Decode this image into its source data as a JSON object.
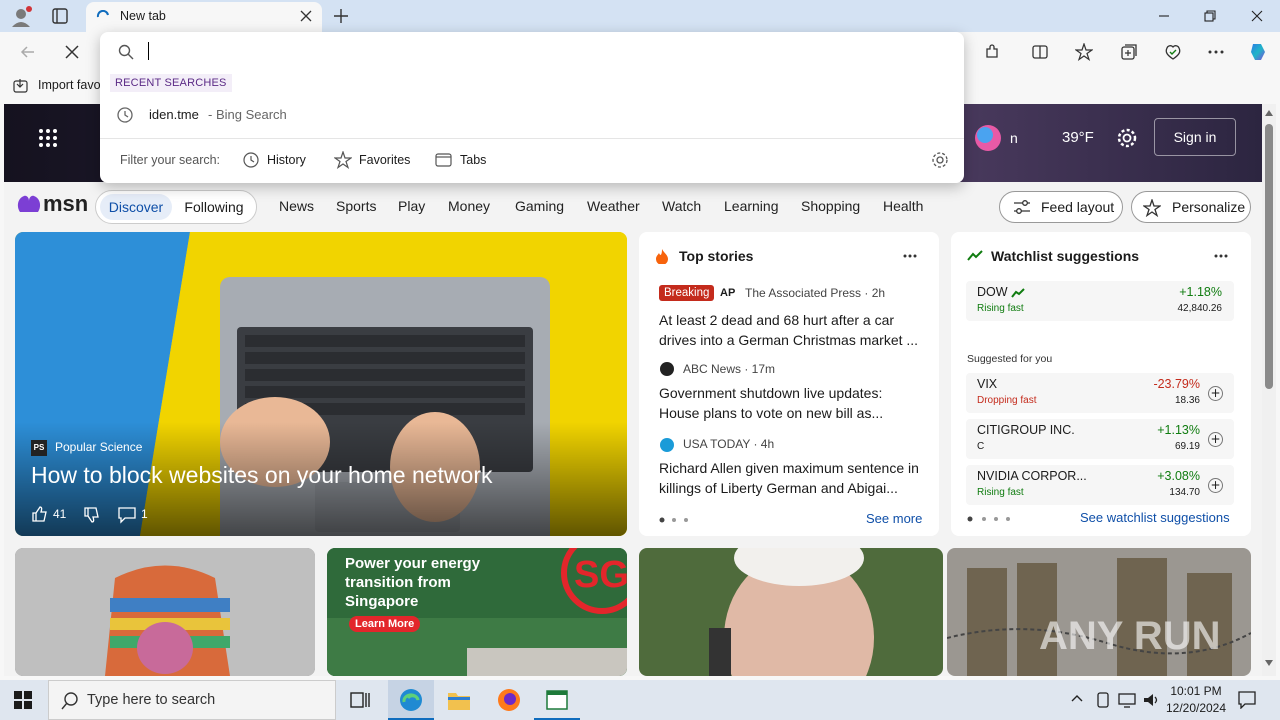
{
  "browser": {
    "tab_title": "New tab",
    "favorites_import": "Import favo",
    "accent": "#0f6cbd"
  },
  "dropdown": {
    "section_label": "RECENT SEARCHES",
    "recent_query": "iden.tme",
    "recent_suffix": "- Bing Search",
    "filter_label": "Filter your search:",
    "filters": [
      "History",
      "Favorites",
      "Tabs"
    ]
  },
  "hero": {
    "signin_partial": "n",
    "temperature": "39°F",
    "signin_button": "Sign in"
  },
  "msn": {
    "logo": "msn",
    "pills": [
      "Discover",
      "Following"
    ],
    "nav": [
      "News",
      "Sports",
      "Play",
      "Money",
      "Gaming",
      "Weather",
      "Watch",
      "Learning",
      "Shopping",
      "Health"
    ],
    "feed_layout": "Feed layout",
    "personalize": "Personalize"
  },
  "feature": {
    "source": "Popular Science",
    "source_badge": "PS",
    "headline": "How to block websites on your home network",
    "likes": "41",
    "comments": "1"
  },
  "top_stories": {
    "title": "Top stories",
    "items": [
      {
        "badge": "Breaking",
        "source_logo": "AP",
        "source": "The Associated Press · 2h",
        "headline": "At least 2 dead and 68 hurt after a car drives into a German Christmas market ..."
      },
      {
        "source": "ABC News · 17m",
        "headline": "Government shutdown live updates: House plans to vote on new bill as..."
      },
      {
        "source": "USA TODAY · 4h",
        "headline": "Richard Allen given maximum sentence in killings of Liberty German and Abigai..."
      }
    ],
    "see_more": "See more"
  },
  "watchlist": {
    "title": "Watchlist suggestions",
    "main": {
      "symbol": "DOW",
      "change": "+1.18%",
      "status": "Rising fast",
      "value": "42,840.26"
    },
    "suggested_label": "Suggested for you",
    "suggested": [
      {
        "symbol": "VIX",
        "change": "-23.79%",
        "status": "Dropping fast",
        "value": "18.36",
        "color": "#c42b1c"
      },
      {
        "symbol": "CITIGROUP INC.",
        "change": "+1.13%",
        "status": "C",
        "value": "69.19",
        "color": "#107c10"
      },
      {
        "symbol": "NVIDIA CORPOR...",
        "change": "+3.08%",
        "status": "Rising fast",
        "value": "134.70",
        "color": "#107c10"
      }
    ],
    "see_link": "See watchlist suggestions"
  },
  "ad": {
    "headline": "Power your energy transition from Singapore",
    "cta": "Learn More",
    "brand": "SG"
  },
  "watermark": "ANY RUN",
  "taskbar": {
    "search_placeholder": "Type here to search",
    "time": "10:01 PM",
    "date": "12/20/2024"
  }
}
